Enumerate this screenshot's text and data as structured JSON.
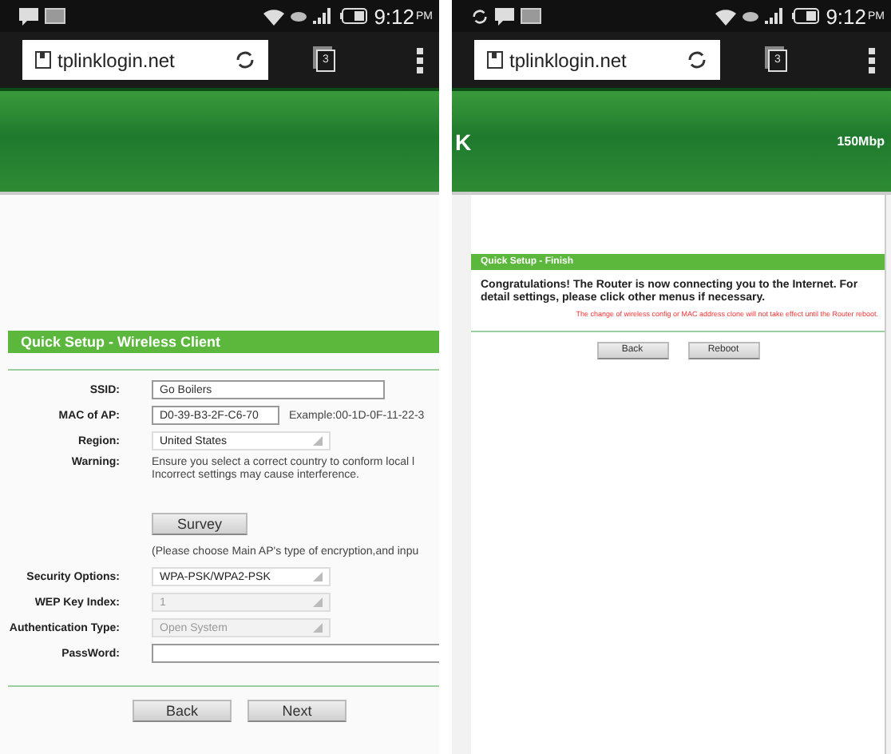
{
  "screens": [
    {
      "status_bar": {
        "time": "9:12",
        "ampm": "PM"
      },
      "url": "tplinklogin.net",
      "tab_count": "3",
      "section_title": "Quick Setup - Wireless Client",
      "rows": [
        {
          "kind": "input",
          "label": "SSID:",
          "value": "Go Boilers"
        },
        {
          "kind": "input",
          "label": "MAC of AP:",
          "value": "D0-39-B3-2F-C6-70",
          "hint": "Example:00-1D-0F-11-22-3"
        },
        {
          "kind": "select",
          "label": "Region:",
          "value": "United States",
          "disabled": false
        },
        {
          "kind": "text",
          "label": "Warning:",
          "lines": [
            "Ensure you select a correct country to conform local l",
            "Incorrect settings may cause interference."
          ]
        },
        {
          "kind": "button",
          "label": "Survey"
        },
        {
          "kind": "note",
          "text": "(Please choose Main AP's type of encryption,and inpu"
        },
        {
          "kind": "select",
          "label": "Security Options:",
          "value": "WPA-PSK/WPA2-PSK",
          "disabled": false
        },
        {
          "kind": "select",
          "label": "WEP Key Index:",
          "value": "1",
          "disabled": true
        },
        {
          "kind": "select",
          "label": "Authentication Type:",
          "value": "Open System",
          "disabled": true
        },
        {
          "kind": "password",
          "label": "PassWord:"
        }
      ],
      "buttons": [
        "Back",
        "Next"
      ]
    },
    {
      "status_bar": {
        "sync": true,
        "time": "9:12",
        "ampm": "PM"
      },
      "url": "tplinklogin.net",
      "tab_count": "3",
      "banner": {
        "logo_fragment": "K",
        "speed": "150Mbp"
      },
      "section_title": "Quick Setup - Finish",
      "message": "Congratulations! The Router is now connecting you to the Internet. For detail settings, please click other menus if necessary.",
      "warning": "The change of wireless config or MAC address clone will not take effect until the Router reboot.",
      "buttons": [
        "Back",
        "Reboot"
      ]
    }
  ]
}
